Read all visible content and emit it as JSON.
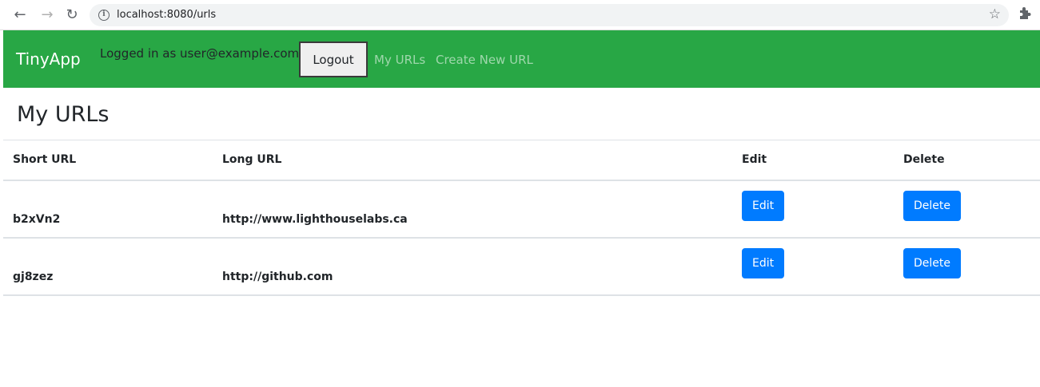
{
  "browser": {
    "url": "localhost:8080/urls"
  },
  "navbar": {
    "brand": "TinyApp",
    "login_status": "Logged in as user@example.com",
    "logout_label": "Logout",
    "links": [
      "My URLs",
      "Create New URL"
    ],
    "background_color": "#28a745"
  },
  "main": {
    "title": "My URLs",
    "table": {
      "headers": [
        "Short URL",
        "Long URL",
        "Edit",
        "Delete"
      ],
      "rows": [
        {
          "short_url": "b2xVn2",
          "long_url": "http://www.lighthouselabs.ca",
          "edit_label": "Edit",
          "delete_label": "Delete"
        },
        {
          "short_url": "gj8zez",
          "long_url": "http://github.com",
          "edit_label": "Edit",
          "delete_label": "Delete"
        }
      ]
    },
    "button_color": "#007bff"
  }
}
